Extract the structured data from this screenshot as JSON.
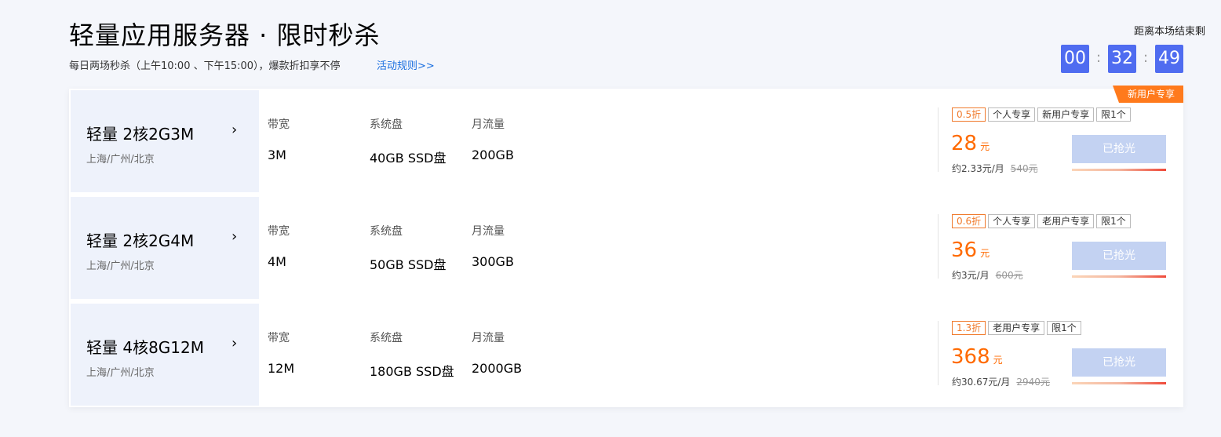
{
  "header": {
    "title": "轻量应用服务器 · 限时秒杀",
    "subtitle": "每日两场秒杀（上午10:00 、下午15:00），爆款折扣享不停",
    "rules_link": "活动规则>>",
    "countdown_label": "距离本场结束剩",
    "countdown": {
      "hours": "00",
      "minutes": "32",
      "seconds": "49",
      "sep": ":"
    }
  },
  "labels": {
    "bandwidth": "带宽",
    "disk": "系统盘",
    "traffic": "月流量",
    "currency": "元",
    "sold_out": "已抢光"
  },
  "ribbon": "新用户专享",
  "products": [
    {
      "name": "轻量 2核2G3M",
      "arrow": "›",
      "regions": "上海/广州/北京",
      "bandwidth": "3M",
      "disk": "40GB SSD盘",
      "traffic": "200GB",
      "tags": [
        "0.5折",
        "个人专享",
        "新用户专享",
        "限1个"
      ],
      "price": "28",
      "monthly": "约2.33元/月",
      "original": "540元",
      "sold_progress": 1.0
    },
    {
      "name": "轻量 2核2G4M",
      "arrow": "›",
      "regions": "上海/广州/北京",
      "bandwidth": "4M",
      "disk": "50GB SSD盘",
      "traffic": "300GB",
      "tags": [
        "0.6折",
        "个人专享",
        "老用户专享",
        "限1个"
      ],
      "price": "36",
      "monthly": "约3元/月",
      "original": "600元",
      "sold_progress": 1.0
    },
    {
      "name": "轻量 4核8G12M",
      "arrow": "›",
      "regions": "上海/广州/北京",
      "bandwidth": "12M",
      "disk": "180GB SSD盘",
      "traffic": "2000GB",
      "tags": [
        "1.3折",
        "老用户专享",
        "限1个"
      ],
      "price": "368",
      "monthly": "约30.67元/月",
      "original": "2940元",
      "sold_progress": 1.0
    }
  ]
}
